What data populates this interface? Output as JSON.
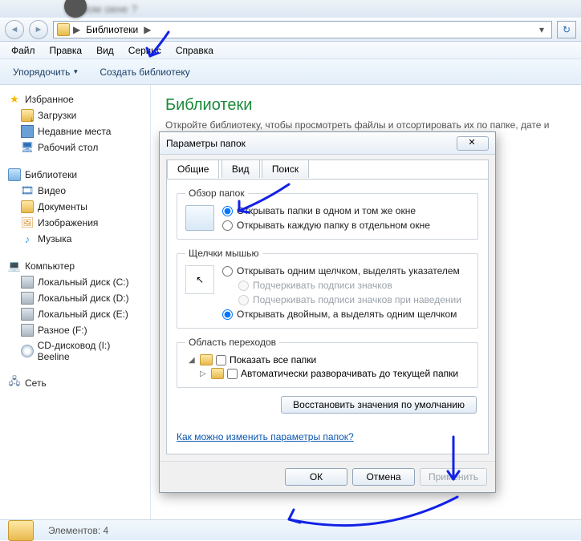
{
  "titlebar_blur": "новом окне ?",
  "breadcrumb": {
    "root_arrow": "▶",
    "crumb1": "Библиотеки",
    "sep": "▶",
    "dropdown": "▾"
  },
  "menubar": [
    "Файл",
    "Правка",
    "Вид",
    "Сервис",
    "Справка"
  ],
  "toolbar": {
    "organize": "Упорядочить",
    "newlib": "Создать библиотеку"
  },
  "sidebar": {
    "fav": {
      "head": "Избранное",
      "items": [
        "Загрузки",
        "Недавние места",
        "Рабочий стол"
      ]
    },
    "lib": {
      "head": "Библиотеки",
      "items": [
        "Видео",
        "Документы",
        "Изображения",
        "Музыка"
      ]
    },
    "pc": {
      "head": "Компьютер",
      "items": [
        "Локальный диск (C:)",
        "Локальный диск (D:)",
        "Локальный диск (E:)",
        "Разное (F:)",
        "CD-дисковод (I:) Beeline"
      ]
    },
    "net": {
      "head": "Сеть"
    }
  },
  "content": {
    "title": "Библиотеки",
    "desc": "Откройте библиотеку, чтобы просмотреть файлы и отсортировать их по папке, дате и други"
  },
  "statusbar": {
    "label": "Элементов:",
    "count": "4"
  },
  "dialog": {
    "title": "Параметры папок",
    "close": "✕",
    "tabs": [
      "Общие",
      "Вид",
      "Поиск"
    ],
    "fs_browse": {
      "legend": "Обзор папок",
      "opt1": "Открывать папки в одном и том же окне",
      "opt2": "Открывать каждую папку в отдельном окне"
    },
    "fs_click": {
      "legend": "Щелчки мышью",
      "opt1": "Открывать одним щелчком, выделять указателем",
      "sub1": "Подчеркивать подписи значков",
      "sub2": "Подчеркивать подписи значков при наведении",
      "opt2": "Открывать двойным, а выделять одним щелчком"
    },
    "fs_nav": {
      "legend": "Область переходов",
      "chk1": "Показать все папки",
      "chk2": "Автоматически разворачивать до текущей папки"
    },
    "restore": "Восстановить значения по умолчанию",
    "help": "Как можно изменить параметры папок?",
    "buttons": {
      "ok": "ОК",
      "cancel": "Отмена",
      "apply": "Применить"
    }
  }
}
